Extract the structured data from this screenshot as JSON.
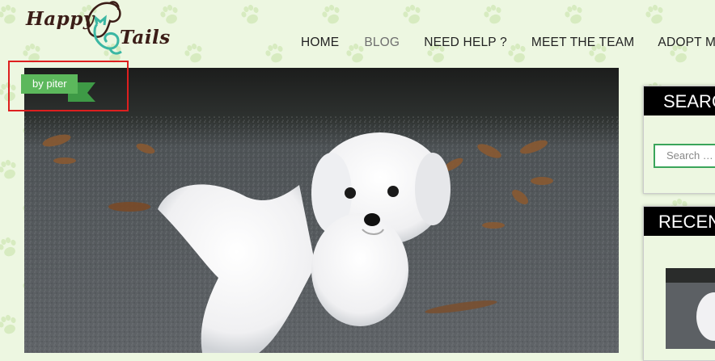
{
  "logo": {
    "line1": "Happy",
    "line2": "Tails"
  },
  "nav": {
    "items": [
      {
        "label": "HOME",
        "active": false
      },
      {
        "label": "BLOG",
        "active": true
      },
      {
        "label": "NEED HELP ?",
        "active": false
      },
      {
        "label": "MEET THE TEAM",
        "active": false
      },
      {
        "label": "ADOPT ME",
        "active": false
      }
    ]
  },
  "post": {
    "author_tag": "by piter",
    "image_alt": "white fluffy puppy"
  },
  "sidebar": {
    "search": {
      "title": "SEARCH",
      "placeholder": "Search …"
    },
    "recent": {
      "title": "RECENT POSTS"
    }
  },
  "colors": {
    "background": "#edf7e1",
    "accent_green": "#5cb85c",
    "highlight_red": "#dd1f1f",
    "logo_brown": "#3b1d17",
    "logo_teal": "#3bb7a3"
  },
  "icons": [
    "paw-print-icon",
    "dog-cat-logo-icon"
  ]
}
